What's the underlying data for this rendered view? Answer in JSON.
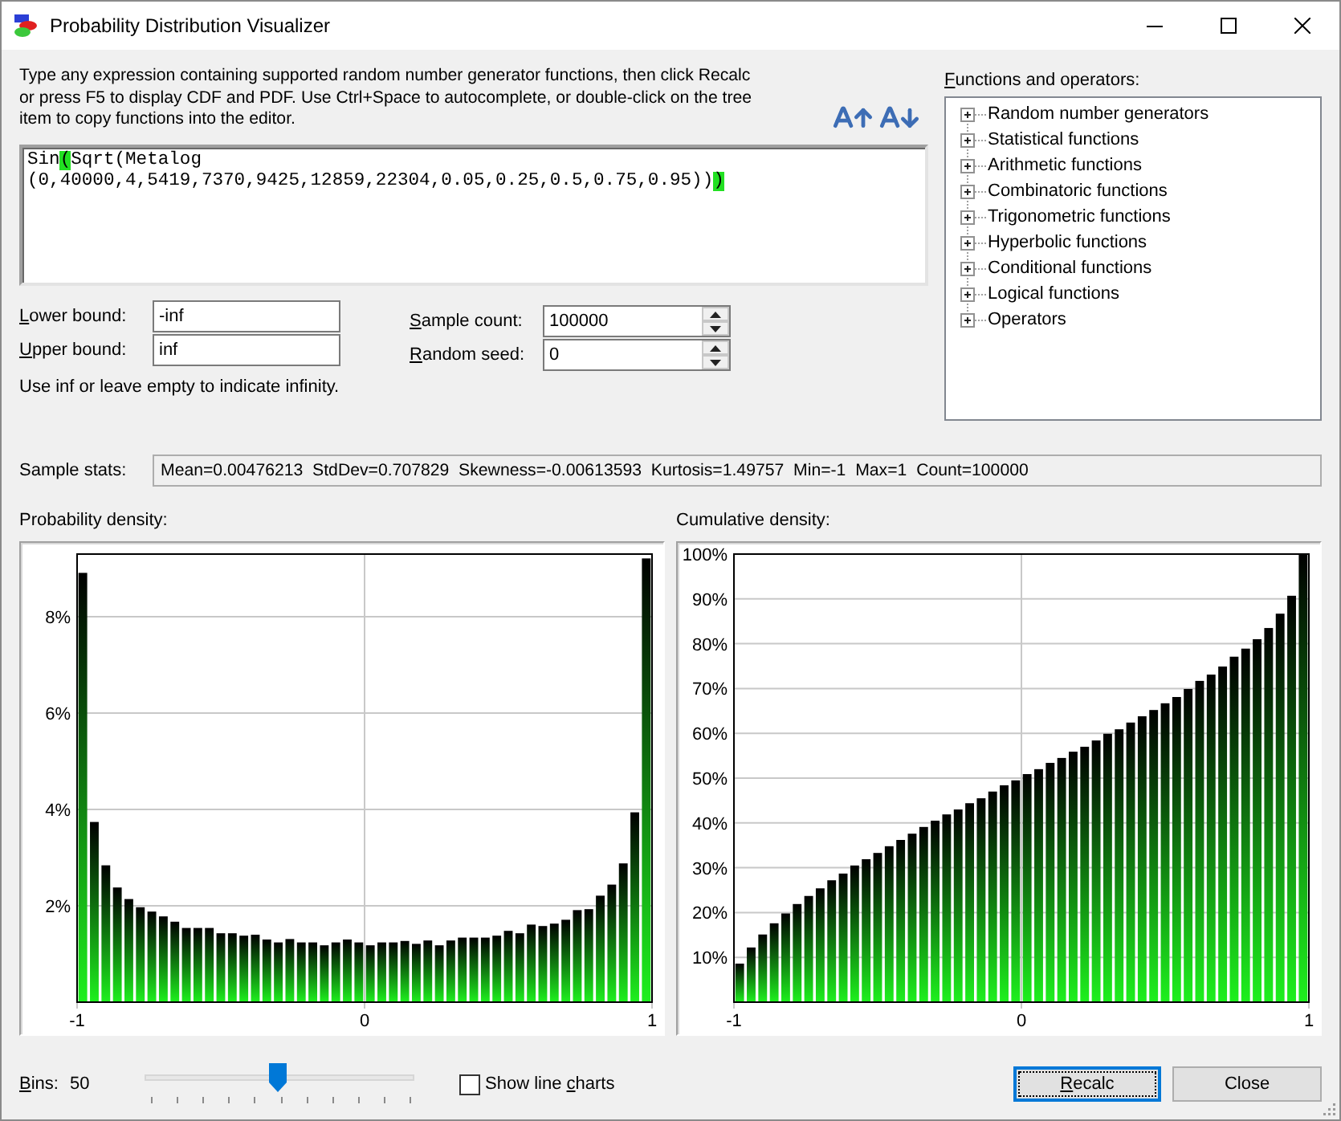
{
  "window": {
    "title": "Probability Distribution Visualizer"
  },
  "instructions": {
    "lines": [
      "Type any expression containing supported random number generator functions, then click Recalc",
      "or press F5 to display CDF and PDF. Use Ctrl+Space to autocomplete, or double-click on the tree",
      "item to copy functions into the editor."
    ]
  },
  "editor": {
    "lines": [
      [
        {
          "text": "Sin",
          "highlighted": false
        },
        {
          "text": "(",
          "highlighted": true
        },
        {
          "text": "Sqrt(Metalog",
          "highlighted": false
        }
      ],
      [
        {
          "text": "(0,40000,4,5419,7370,9425,12859,22304,0.05,0.25,0.5,0.75,0.95))",
          "highlighted": false
        },
        {
          "text": ")",
          "highlighted": true
        }
      ]
    ]
  },
  "functions_tree": {
    "label": [
      {
        "text": "F",
        "underlined": true
      },
      {
        "text": "unctions and operators:",
        "underlined": false
      }
    ],
    "items": [
      {
        "label": "Random number generators",
        "expanded": false
      },
      {
        "label": "Statistical functions",
        "expanded": false
      },
      {
        "label": "Arithmetic functions",
        "expanded": false
      },
      {
        "label": "Combinatoric functions",
        "expanded": false
      },
      {
        "label": "Trigonometric functions",
        "expanded": false
      },
      {
        "label": "Hyperbolic functions",
        "expanded": false
      },
      {
        "label": "Conditional functions",
        "expanded": false
      },
      {
        "label": "Logical functions",
        "expanded": false
      },
      {
        "label": "Operators",
        "expanded": false
      }
    ]
  },
  "bounds": [
    {
      "label": [
        {
          "text": "L",
          "underlined": true
        },
        {
          "text": "ower bound:",
          "underlined": false
        }
      ],
      "value": "-inf"
    },
    {
      "label": [
        {
          "text": "U",
          "underlined": true
        },
        {
          "text": "pper bound:",
          "underlined": false
        }
      ],
      "value": "inf"
    }
  ],
  "bounds_note": "Use inf or leave empty to indicate infinity.",
  "sampling": [
    {
      "label": [
        {
          "text": "S",
          "underlined": true
        },
        {
          "text": "ample count:",
          "underlined": false
        }
      ],
      "value": "100000"
    },
    {
      "label": [
        {
          "text": "R",
          "underlined": true
        },
        {
          "text": "andom seed:",
          "underlined": false
        }
      ],
      "value": "0"
    }
  ],
  "sample_stats": {
    "label": "Sample stats:",
    "value": "Mean=0.00476213  StdDev=0.707829  Skewness=-0.00613593  Kurtosis=1.49757  Min=-1  Max=1  Count=100000"
  },
  "charts": [
    {
      "chart_data": {
        "type": "bar",
        "title": "Probability density:",
        "grid": true,
        "x": [
          -0.98,
          -0.94,
          -0.9,
          -0.86,
          -0.82,
          -0.78,
          -0.74,
          -0.7,
          -0.66,
          -0.62,
          -0.58,
          -0.54,
          -0.5,
          -0.46,
          -0.42,
          -0.38,
          -0.34,
          -0.3,
          -0.26,
          -0.22,
          -0.18,
          -0.14,
          -0.1,
          -0.06,
          -0.02,
          0.02,
          0.06,
          0.1,
          0.14,
          0.18,
          0.22,
          0.26,
          0.3,
          0.34,
          0.38,
          0.42,
          0.46,
          0.5,
          0.54,
          0.58,
          0.62,
          0.66,
          0.7,
          0.74,
          0.78,
          0.82,
          0.86,
          0.9,
          0.94,
          0.98
        ],
        "values": [
          8.91,
          3.74,
          2.84,
          2.38,
          2.14,
          1.97,
          1.88,
          1.78,
          1.67,
          1.54,
          1.54,
          1.54,
          1.43,
          1.43,
          1.38,
          1.4,
          1.3,
          1.24,
          1.31,
          1.24,
          1.24,
          1.18,
          1.24,
          1.3,
          1.24,
          1.18,
          1.24,
          1.24,
          1.27,
          1.21,
          1.28,
          1.18,
          1.28,
          1.34,
          1.34,
          1.34,
          1.38,
          1.48,
          1.43,
          1.61,
          1.58,
          1.63,
          1.71,
          1.91,
          1.93,
          2.21,
          2.44,
          2.88,
          3.94,
          9.21
        ],
        "xlim": [
          -1,
          1
        ],
        "ylim": [
          0,
          9.3
        ],
        "xticks": [
          -1,
          0,
          1
        ],
        "yticks": [
          {
            "value": 2,
            "label": "2%"
          },
          {
            "value": 4,
            "label": "4%"
          },
          {
            "value": 6,
            "label": "6%"
          },
          {
            "value": 8,
            "label": "8%"
          }
        ]
      }
    },
    {
      "chart_data": {
        "type": "bar",
        "title": "Cumulative density:",
        "grid": true,
        "x": [
          -0.98,
          -0.94,
          -0.9,
          -0.86,
          -0.82,
          -0.78,
          -0.74,
          -0.7,
          -0.66,
          -0.62,
          -0.58,
          -0.54,
          -0.5,
          -0.46,
          -0.42,
          -0.38,
          -0.34,
          -0.3,
          -0.26,
          -0.22,
          -0.18,
          -0.14,
          -0.1,
          -0.06,
          -0.02,
          0.02,
          0.06,
          0.1,
          0.14,
          0.18,
          0.22,
          0.26,
          0.3,
          0.34,
          0.38,
          0.42,
          0.46,
          0.5,
          0.54,
          0.58,
          0.62,
          0.66,
          0.7,
          0.74,
          0.78,
          0.82,
          0.86,
          0.9,
          0.94,
          0.98
        ],
        "values": [
          8.6,
          12.2,
          15.1,
          17.6,
          19.8,
          21.9,
          23.7,
          25.4,
          27.2,
          28.7,
          30.5,
          31.9,
          33.3,
          34.8,
          36.2,
          37.6,
          39.1,
          40.5,
          41.9,
          43,
          44.4,
          45.5,
          47,
          48.4,
          49.5,
          50.9,
          52,
          53.4,
          54.5,
          55.9,
          57,
          58.4,
          59.9,
          60.9,
          62.4,
          63.8,
          65.2,
          66.7,
          68.1,
          69.9,
          71.7,
          73.1,
          74.9,
          77.1,
          78.9,
          81,
          83.5,
          86.7,
          90.7,
          100
        ],
        "xlim": [
          -1,
          1
        ],
        "ylim": [
          0,
          100
        ],
        "xticks": [
          -1,
          0,
          1
        ],
        "yticks": [
          {
            "value": 10,
            "label": "10%"
          },
          {
            "value": 20,
            "label": "20%"
          },
          {
            "value": 30,
            "label": "30%"
          },
          {
            "value": 40,
            "label": "40%"
          },
          {
            "value": 50,
            "label": "50%"
          },
          {
            "value": 60,
            "label": "60%"
          },
          {
            "value": 70,
            "label": "70%"
          },
          {
            "value": 80,
            "label": "80%"
          },
          {
            "value": 90,
            "label": "90%"
          },
          {
            "value": 100,
            "label": "100%"
          }
        ]
      }
    }
  ],
  "bins": {
    "label": [
      {
        "text": "B",
        "underlined": true
      },
      {
        "text": "ins:",
        "underlined": false
      }
    ],
    "value": "50",
    "level": 0.49
  },
  "show_line_charts": {
    "label": [
      {
        "text": "Show line ",
        "underlined": false
      },
      {
        "text": "c",
        "underlined": true
      },
      {
        "text": "harts",
        "underlined": false
      }
    ],
    "checked": false
  },
  "buttons": [
    {
      "label": [
        {
          "text": "R",
          "underlined": true
        },
        {
          "text": "ecalc",
          "underlined": false
        }
      ],
      "default": true
    },
    {
      "label": [
        {
          "text": "Close",
          "underlined": false
        }
      ],
      "default": false
    }
  ]
}
